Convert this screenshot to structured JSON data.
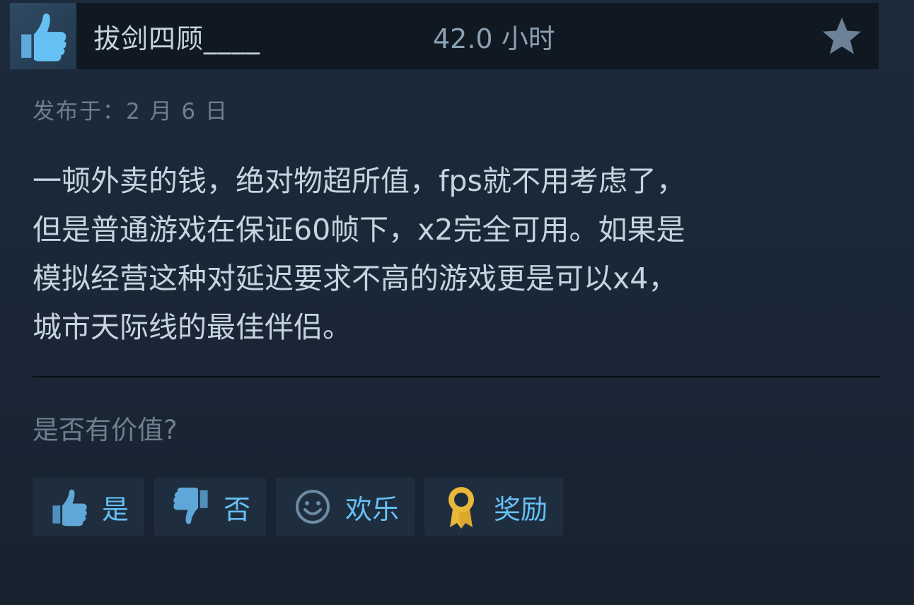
{
  "review": {
    "author": "拔剑四顾____",
    "playtime": "42.0 小时",
    "posted": "发布于：2 月 6 日",
    "body": "一顿外卖的钱，绝对物超所值，fps就不用考虑了，\n但是普通游戏在保证60帧下，x2完全可用。如果是\n模拟经营这种对延迟要求不高的游戏更是可以x4，\n城市天际线的最佳伴侣。",
    "helpful_question": "是否有价值?"
  },
  "actions": {
    "yes": "是",
    "no": "否",
    "funny": "欢乐",
    "award": "奖励"
  },
  "icons": {
    "recommended": "thumbs-up-icon",
    "favorite": "star-icon",
    "yes": "thumbs-up-icon",
    "no": "thumbs-down-icon",
    "funny": "smiley-icon",
    "award": "award-ribbon-icon"
  },
  "colors": {
    "background": "#1b2838",
    "accent": "#66c0f4",
    "text": "#c6d4df",
    "muted": "#6f7f8d",
    "award": "#e8b93a"
  }
}
